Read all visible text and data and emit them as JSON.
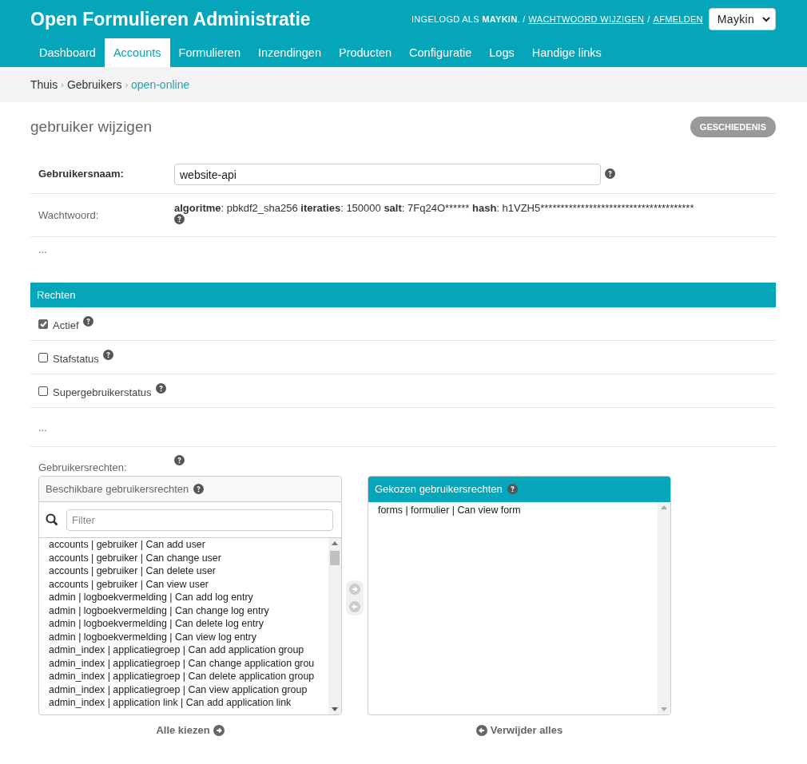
{
  "header": {
    "title": "Open Formulieren Administratie",
    "user_tools": {
      "logged_in_prefix": "INGELOGD ALS",
      "username": "MAYKIN",
      "separator_1": ". /",
      "change_password": "WACHTWOORD WIJZIGEN",
      "separator_2": "/",
      "logout": "AFMELDEN"
    },
    "user_select": {
      "value": "Maykin"
    }
  },
  "nav": [
    {
      "label": "Dashboard",
      "selected": false
    },
    {
      "label": "Accounts",
      "selected": true
    },
    {
      "label": "Formulieren",
      "selected": false
    },
    {
      "label": "Inzendingen",
      "selected": false
    },
    {
      "label": "Producten",
      "selected": false
    },
    {
      "label": "Configuratie",
      "selected": false
    },
    {
      "label": "Logs",
      "selected": false
    },
    {
      "label": "Handige links",
      "selected": false
    }
  ],
  "breadcrumbs": [
    {
      "label": "Thuis",
      "current": false
    },
    {
      "separator": "›",
      "label": "Gebruikers",
      "current": false
    },
    {
      "separator": "›",
      "label": "open-online",
      "current": true
    }
  ],
  "page_title": "gebruiker wijzigen",
  "history_button": "GESCHIEDENIS",
  "fields": {
    "username": {
      "label": "Gebruikersnaam:",
      "value": "website-api"
    },
    "password": {
      "label": "Wachtwoord:",
      "parts": [
        {
          "key": "algoritme",
          "value": ": pbkdf2_sha256"
        },
        {
          "key": "iteraties",
          "value": ": 150000"
        },
        {
          "key": "salt",
          "value": ": 7Fq24O******"
        },
        {
          "key": "hash",
          "value": ": h1VZH5**************************************"
        }
      ]
    },
    "ellipsis": "..."
  },
  "rights": {
    "title": "Rechten",
    "checkboxes": [
      {
        "label": "Actief",
        "checked": true
      },
      {
        "label": "Stafstatus",
        "checked": false
      },
      {
        "label": "Supergebruikerstatus",
        "checked": false
      }
    ],
    "ellipsis": "...",
    "permissions_label": "Gebruikersrechten:"
  },
  "available": {
    "title": "Beschikbare gebruikersrechten",
    "filter_placeholder": "Filter",
    "items": [
      {
        "text": "accounts | gebruiker | Can add user"
      },
      {
        "text": "accounts | gebruiker | Can change user"
      },
      {
        "text": "accounts | gebruiker | Can delete user"
      },
      {
        "text": "accounts | gebruiker | Can view user"
      },
      {
        "text": "admin | logboekvermelding | Can add log entry"
      },
      {
        "text": "admin | logboekvermelding | Can change log entry"
      },
      {
        "text": "admin | logboekvermelding | Can delete log entry"
      },
      {
        "text": "admin | logboekvermelding | Can view log entry"
      },
      {
        "text": "admin_index | applicatiegroep | Can add application group"
      },
      {
        "text": "admin_index | applicatiegroep | Can change application grou"
      },
      {
        "text": "admin_index | applicatiegroep | Can delete application group"
      },
      {
        "text": "admin_index | applicatiegroep | Can view application group"
      },
      {
        "text": "admin_index | application link | Can add application link"
      }
    ],
    "choose_all": "Alle kiezen"
  },
  "chosen": {
    "title": "Gekozen gebruikersrechten",
    "items": [
      {
        "text": "forms | formulier | Can view form"
      }
    ],
    "remove_all": "Verwijder alles"
  }
}
